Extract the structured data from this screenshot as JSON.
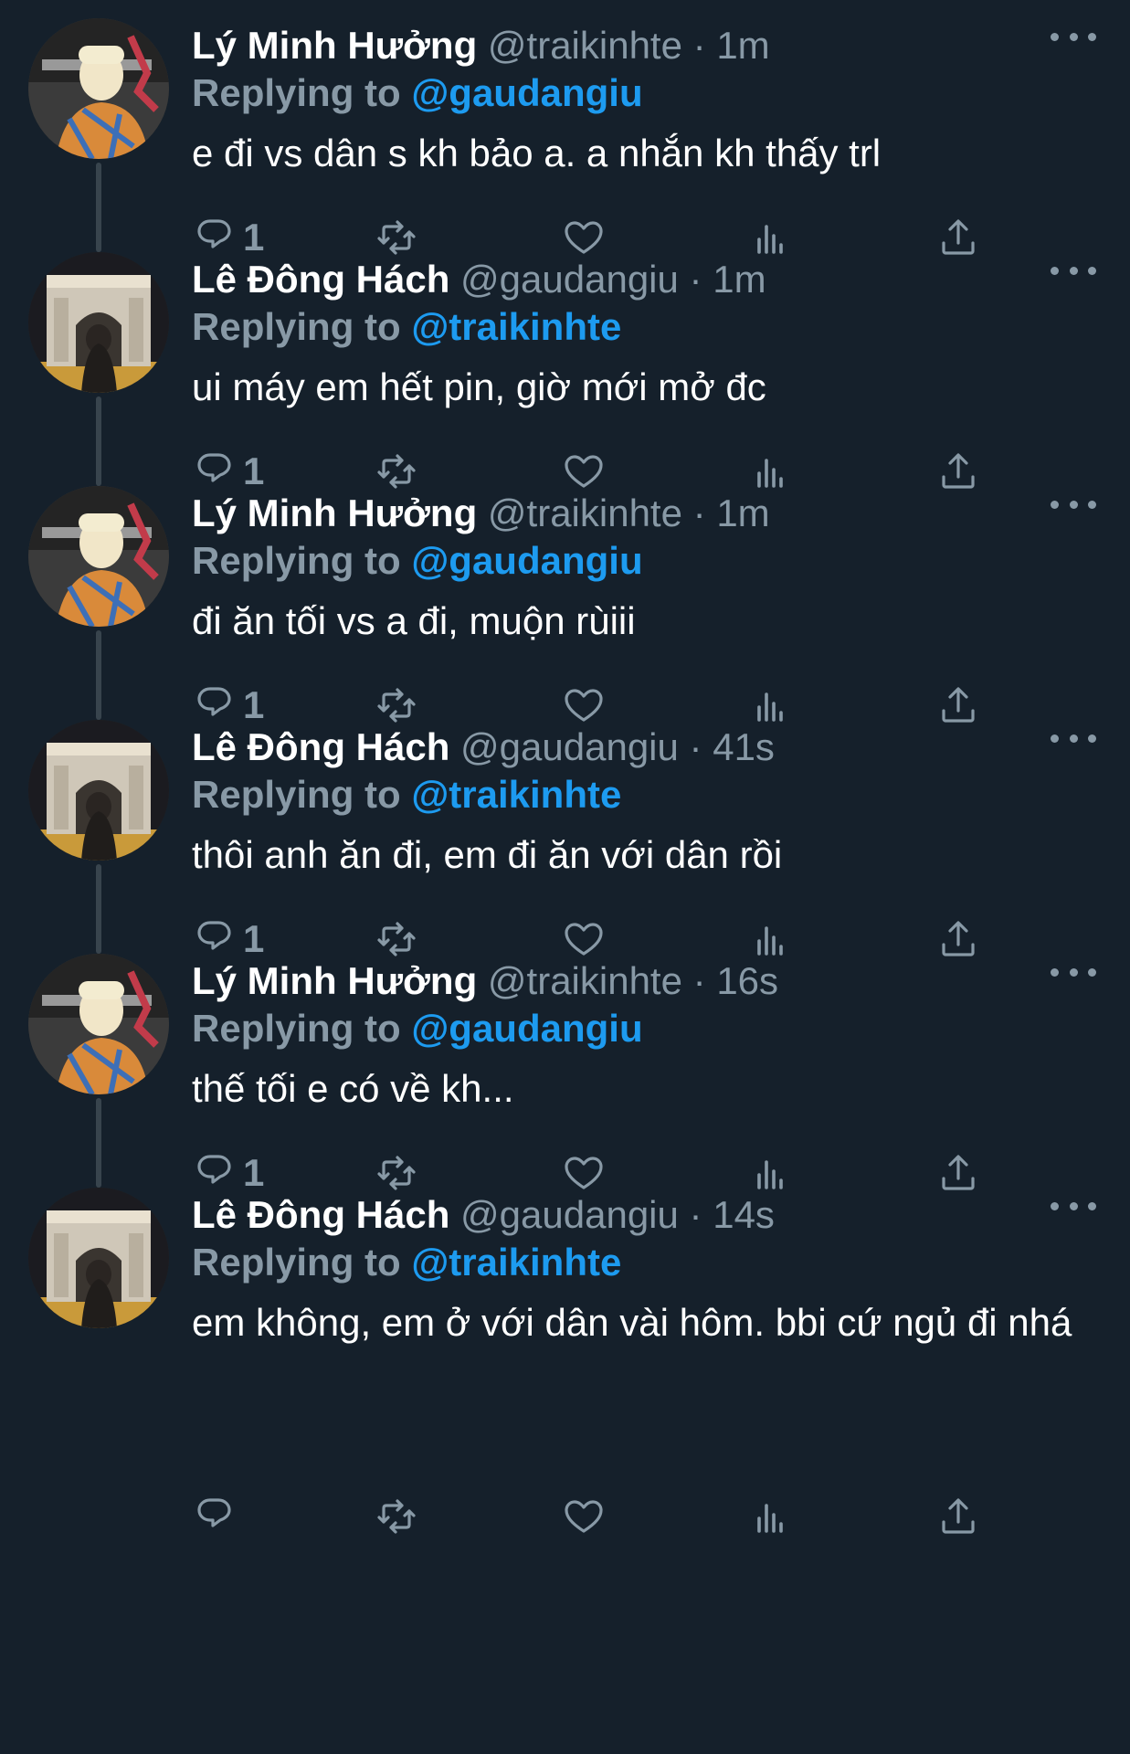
{
  "colors": {
    "background": "#15202b",
    "secondary_text": "#8899a6",
    "link": "#1d9bf0",
    "thread_line": "#38444d"
  },
  "tweets": [
    {
      "name": "Lý Minh Hưởng",
      "handle": "@traikinhte",
      "separator": "·",
      "time": "1m",
      "replying_prefix": "Replying to",
      "reply_to": "@gaudangiu",
      "text": "e đi vs dân s kh bảo a. a nhắn kh thấy trl",
      "reply_count": "1",
      "avatar": "avatar-photo"
    },
    {
      "name": "Lê Đông Hách",
      "handle": "@gaudangiu",
      "separator": "·",
      "time": "1m",
      "replying_prefix": "Replying to",
      "reply_to": "@traikinhte",
      "text": "ui máy em hết pin, giờ mới mở đc",
      "reply_count": "1",
      "avatar": "avatar-photo"
    },
    {
      "name": "Lý Minh Hưởng",
      "handle": "@traikinhte",
      "separator": "·",
      "time": "1m",
      "replying_prefix": "Replying to",
      "reply_to": "@gaudangiu",
      "text": "đi ăn tối vs a đi, muộn rùiii",
      "reply_count": "1",
      "avatar": "avatar-photo"
    },
    {
      "name": "Lê Đông Hách",
      "handle": "@gaudangiu",
      "separator": "·",
      "time": "41s",
      "replying_prefix": "Replying to",
      "reply_to": "@traikinhte",
      "text": "thôi anh ăn đi, em đi ăn với dân rồi",
      "reply_count": "1",
      "avatar": "avatar-photo"
    },
    {
      "name": "Lý Minh Hưởng",
      "handle": "@traikinhte",
      "separator": "·",
      "time": "16s",
      "replying_prefix": "Replying to",
      "reply_to": "@gaudangiu",
      "text": "thế tối e có về kh...",
      "reply_count": "1",
      "avatar": "avatar-photo"
    },
    {
      "name": "Lê Đông Hách",
      "handle": "@gaudangiu",
      "separator": "·",
      "time": "14s",
      "replying_prefix": "Replying to",
      "reply_to": "@traikinhte",
      "text": "em không, em ở với dân vài hôm. bbi cứ ngủ đi nhá",
      "reply_count": "",
      "avatar": "avatar-photo"
    }
  ],
  "icons": [
    "reply-icon",
    "retweet-icon",
    "like-icon",
    "stats-icon",
    "share-icon",
    "more-icon"
  ]
}
